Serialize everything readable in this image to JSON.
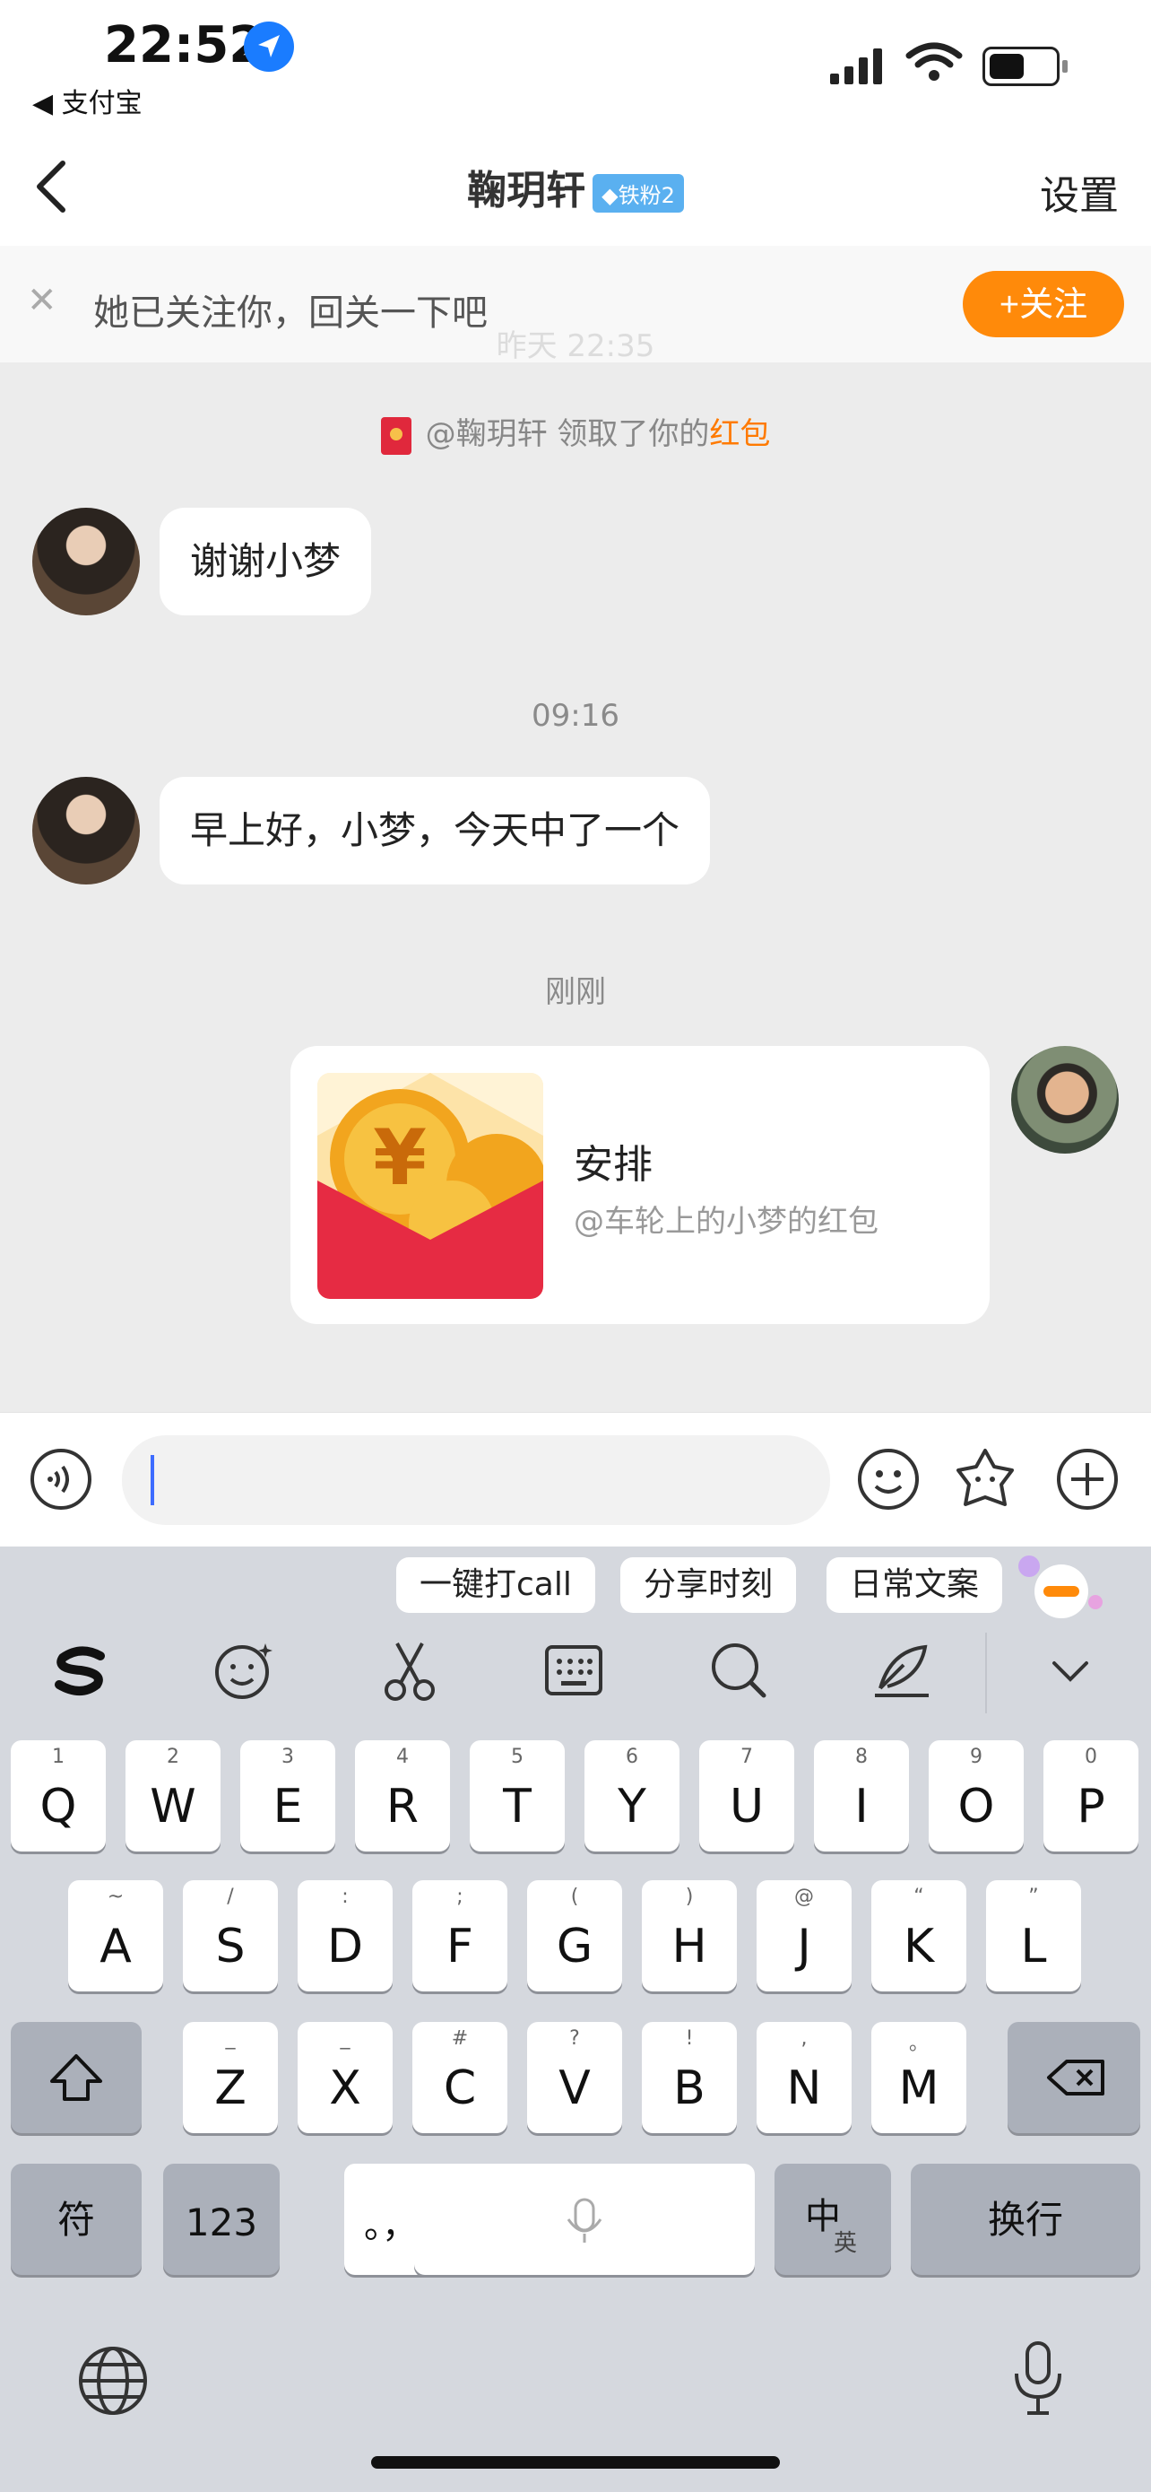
{
  "status_bar": {
    "time": "22:52",
    "back_app": "◀ 支付宝"
  },
  "nav": {
    "title": "鞠玥轩",
    "badge": "◆铁粉2",
    "right": "设置"
  },
  "follow_banner": {
    "text": "她已关注你，回关一下吧",
    "button": "+关注",
    "faint_time": "昨天 22:35"
  },
  "chat": {
    "system_prefix": "@鞠玥轩 领取了你的",
    "system_red": "红包",
    "messages": [
      {
        "text": "谢谢小梦"
      },
      {
        "time": "09:16",
        "text": "早上好，小梦，今天中了一个"
      },
      {
        "time": "刚刚"
      }
    ],
    "red_packet": {
      "title": "安排",
      "subtitle": "@车轮上的小梦的红包"
    }
  },
  "input": {
    "placeholder": ""
  },
  "keyboard": {
    "suggestions": [
      "一键打call",
      "分享时刻",
      "日常文案"
    ],
    "row1": [
      {
        "k": "Q",
        "h": "1"
      },
      {
        "k": "W",
        "h": "2"
      },
      {
        "k": "E",
        "h": "3"
      },
      {
        "k": "R",
        "h": "4"
      },
      {
        "k": "T",
        "h": "5"
      },
      {
        "k": "Y",
        "h": "6"
      },
      {
        "k": "U",
        "h": "7"
      },
      {
        "k": "I",
        "h": "8"
      },
      {
        "k": "O",
        "h": "9"
      },
      {
        "k": "P",
        "h": "0"
      }
    ],
    "row2": [
      {
        "k": "A",
        "h": "~"
      },
      {
        "k": "S",
        "h": "/"
      },
      {
        "k": "D",
        "h": ":"
      },
      {
        "k": "F",
        "h": ";"
      },
      {
        "k": "G",
        "h": "("
      },
      {
        "k": "H",
        "h": ")"
      },
      {
        "k": "J",
        "h": "@"
      },
      {
        "k": "K",
        "h": "“"
      },
      {
        "k": "L",
        "h": "”"
      }
    ],
    "row3": [
      {
        "k": "Z",
        "h": "_"
      },
      {
        "k": "X",
        "h": "_"
      },
      {
        "k": "C",
        "h": "#"
      },
      {
        "k": "V",
        "h": "?"
      },
      {
        "k": "B",
        "h": "!"
      },
      {
        "k": "N",
        "h": ","
      },
      {
        "k": "M",
        "h": "。"
      }
    ],
    "fu": "符",
    "num": "123",
    "punct": "。，",
    "zh_main": "中",
    "zh_sub": "英",
    "return": "换行"
  }
}
